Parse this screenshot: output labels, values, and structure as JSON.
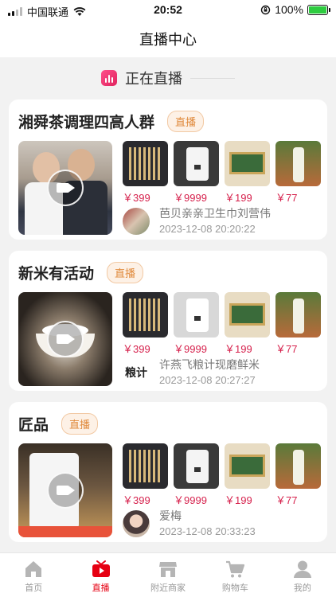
{
  "status_bar": {
    "carrier": "中国联通",
    "time": "20:52",
    "battery": "100%",
    "battery_level": 1.0
  },
  "nav": {
    "title": "直播中心"
  },
  "section": {
    "title": "正在直播"
  },
  "live_tag_label": "直播",
  "cards": [
    {
      "title": "湘舜茶调理四高人群",
      "products": [
        {
          "price": "￥399",
          "icon": "chopsticks-set"
        },
        {
          "price": "￥9999",
          "icon": "water-dispenser"
        },
        {
          "price": "￥199",
          "icon": "gift-box"
        },
        {
          "price": "￥77",
          "icon": "drink-bottle"
        }
      ],
      "shop": {
        "name": "芭贝亲亲卫生巾刘营伟",
        "time": "2023-12-08 20:20:22"
      }
    },
    {
      "title": "新米有活动",
      "products": [
        {
          "price": "￥399",
          "icon": "chopsticks-set"
        },
        {
          "price": "￥9999",
          "icon": "water-dispenser"
        },
        {
          "price": "￥199",
          "icon": "gift-box"
        },
        {
          "price": "￥77",
          "icon": "drink-bottle"
        }
      ],
      "shop": {
        "name": "许燕飞粮计现磨鲜米",
        "time": "2023-12-08 20:27:27",
        "avatar_text": "粮计"
      }
    },
    {
      "title": "匠品",
      "products": [
        {
          "price": "￥399",
          "icon": "chopsticks-set"
        },
        {
          "price": "￥9999",
          "icon": "water-dispenser"
        },
        {
          "price": "￥199",
          "icon": "gift-box"
        },
        {
          "price": "￥77",
          "icon": "drink-bottle"
        }
      ],
      "shop": {
        "name": "爱梅",
        "time": "2023-12-08 20:33:23"
      }
    }
  ],
  "tabbar": {
    "items": [
      {
        "label": "首页",
        "icon": "home-icon"
      },
      {
        "label": "直播",
        "icon": "tv-icon"
      },
      {
        "label": "附近商家",
        "icon": "store-icon"
      },
      {
        "label": "购物车",
        "icon": "cart-icon"
      },
      {
        "label": "我的",
        "icon": "user-icon"
      }
    ],
    "active_color": "#e60012",
    "inactive_color": "#999999"
  }
}
